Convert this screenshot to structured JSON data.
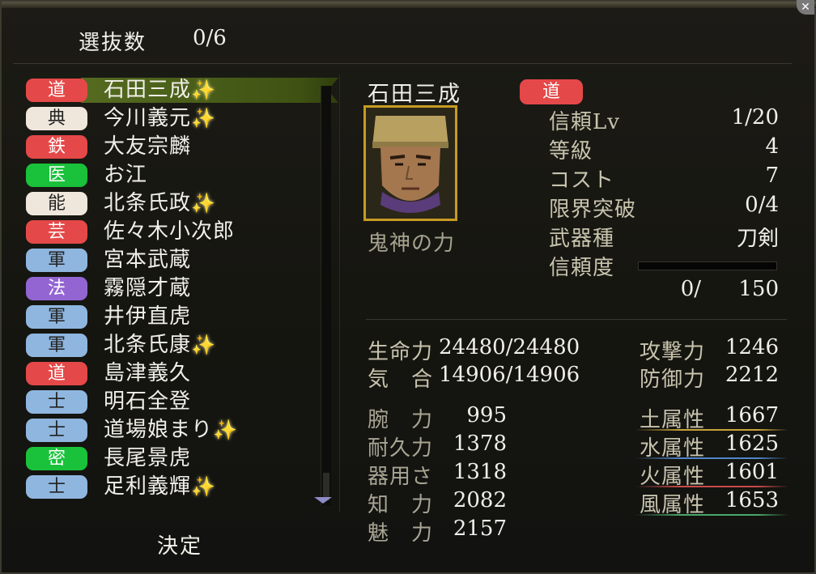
{
  "selection": {
    "label": "選抜数",
    "count": "0/6"
  },
  "list": [
    {
      "badge": "道",
      "color": "red",
      "name": "石田三成",
      "star": true,
      "selected": true
    },
    {
      "badge": "典",
      "color": "cream",
      "name": "今川義元",
      "star": true
    },
    {
      "badge": "鉄",
      "color": "red",
      "name": "大友宗麟",
      "star": false
    },
    {
      "badge": "医",
      "color": "green",
      "name": "お江",
      "star": false
    },
    {
      "badge": "能",
      "color": "cream",
      "name": "北条氏政",
      "star": true
    },
    {
      "badge": "芸",
      "color": "red",
      "name": "佐々木小次郎",
      "star": false
    },
    {
      "badge": "軍",
      "color": "blue",
      "name": "宮本武蔵",
      "star": false
    },
    {
      "badge": "法",
      "color": "purple",
      "name": "霧隠才蔵",
      "star": false
    },
    {
      "badge": "軍",
      "color": "blue",
      "name": "井伊直虎",
      "star": false
    },
    {
      "badge": "軍",
      "color": "blue",
      "name": "北条氏康",
      "star": true
    },
    {
      "badge": "道",
      "color": "red",
      "name": "島津義久",
      "star": false
    },
    {
      "badge": "士",
      "color": "blue",
      "name": "明石全登",
      "star": false
    },
    {
      "badge": "士",
      "color": "blue",
      "name": "道場娘まり",
      "star": true
    },
    {
      "badge": "密",
      "color": "green",
      "name": "長尾景虎",
      "star": false
    },
    {
      "badge": "士",
      "color": "blue",
      "name": "足利義輝",
      "star": true
    }
  ],
  "star_glyph": "✨",
  "decide": "決定",
  "detail": {
    "name": "石田三成",
    "badge": "道",
    "skill": "鬼神の力",
    "stats": [
      {
        "label": "信頼Lv",
        "value": "1/20"
      },
      {
        "label": "等級",
        "value": "4"
      },
      {
        "label": "コスト",
        "value": "7"
      },
      {
        "label": "限界突破",
        "value": "0/4"
      },
      {
        "label": "武器種",
        "value": "刀剣"
      },
      {
        "label": "信頼度",
        "value": ""
      }
    ],
    "trust_progress": 0,
    "trust_text_a": "0/",
    "trust_text_b": "150",
    "life_label": "生命力",
    "life_value": "24480/24480",
    "ki_label": "気　合",
    "ki_value": "14906/14906",
    "attack_label": "攻撃力",
    "attack_value": "1246",
    "defense_label": "防御力",
    "defense_value": "2212",
    "attrs": [
      {
        "label": "腕　力",
        "value": "995"
      },
      {
        "label": "耐久力",
        "value": "1378"
      },
      {
        "label": "器用さ",
        "value": "1318"
      },
      {
        "label": "知　力",
        "value": "2082"
      },
      {
        "label": "魅　力",
        "value": "2157"
      }
    ],
    "elements": [
      {
        "label": "土属性",
        "value": "1667",
        "color": "#c9a33a"
      },
      {
        "label": "水属性",
        "value": "1625",
        "color": "#4f86c9"
      },
      {
        "label": "火属性",
        "value": "1601",
        "color": "#c74a4a"
      },
      {
        "label": "風属性",
        "value": "1653",
        "color": "#4aa86a"
      }
    ]
  },
  "colors": {
    "red": "#e54848",
    "cream": "#efe7dc",
    "green": "#19c23a",
    "blue": "#8fb6df",
    "purple": "#9365d3",
    "frame": "#c79b22"
  }
}
